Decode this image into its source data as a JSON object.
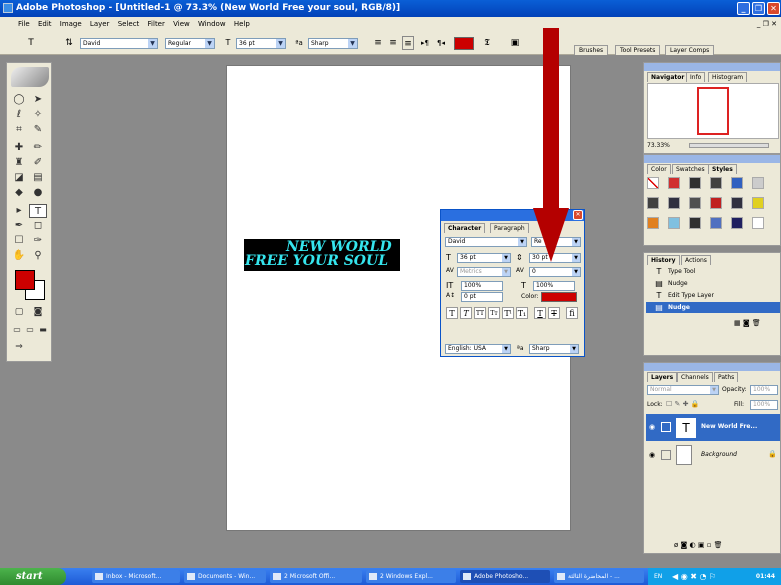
{
  "window": {
    "title": "Adobe Photoshop - [Untitled-1 @ 73.3% (New World Free your soul, RGB/8)]"
  },
  "menu": [
    "File",
    "Edit",
    "Image",
    "Layer",
    "Select",
    "Filter",
    "View",
    "Window",
    "Help"
  ],
  "options": {
    "font_family": "David",
    "font_style": "Regular",
    "font_size": "36 pt",
    "anti_alias": "Sharp",
    "color": "#cc0000",
    "well_tabs": [
      "Brushes",
      "Tool Presets",
      "Layer Comps"
    ]
  },
  "canvas": {
    "text_line1": "NEW WORLD",
    "text_line2": "FREE YOUR SOUL"
  },
  "character_panel": {
    "tabs": [
      "Character",
      "Paragraph"
    ],
    "font": "David",
    "style": "Re",
    "size": "36 pt",
    "leading": "30 pt",
    "kerning": "Metrics",
    "tracking": "0",
    "vscale": "100%",
    "hscale": "100%",
    "baseline": "0 pt",
    "color_label": "Color:",
    "color": "#cc0000",
    "language": "English: USA",
    "aa": "Sharp"
  },
  "navigator": {
    "tabs": [
      "Navigator",
      "Info",
      "Histogram"
    ],
    "zoom": "73.33%"
  },
  "color_panel": {
    "tabs": [
      "Color",
      "Swatches",
      "Styles"
    ],
    "styles": [
      "#ffffff",
      "#d03030",
      "#303030",
      "#404040",
      "#3060c0",
      "#cccccc",
      "#404040",
      "#303040",
      "#505050",
      "#c02020",
      "#303040",
      "#e0d020",
      "#e08020",
      "#80c0e0",
      "#303030",
      "#5070c0",
      "#202060",
      "#ffffff"
    ]
  },
  "history": {
    "tabs": [
      "History",
      "Actions"
    ],
    "items": [
      "Type Tool",
      "Nudge",
      "Edit Type Layer",
      "Nudge"
    ]
  },
  "layers": {
    "tabs": [
      "Layers",
      "Channels",
      "Paths"
    ],
    "blend": "Normal",
    "opacity_label": "Opacity:",
    "opacity": "100%",
    "lock_label": "Lock:",
    "fill_label": "Fill:",
    "fill": "100%",
    "items": [
      "New World Fre...",
      "Background"
    ]
  },
  "taskbar": {
    "start": "start",
    "tasks": [
      "Inbox - Microsoft...",
      "Documents - Win...",
      "2 Microsoft Offi...",
      "2 Windows Expl...",
      "Adobe Photosho...",
      "المحاضرة الثالثة - ..."
    ],
    "lang": "EN",
    "clock": "01:44"
  },
  "arrow_color": "#b40000"
}
